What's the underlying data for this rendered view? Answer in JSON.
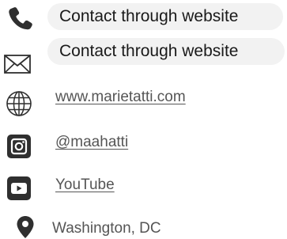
{
  "contacts": {
    "phone": {
      "icon": "phone-icon",
      "label": "Contact through website"
    },
    "email": {
      "icon": "envelope-icon",
      "label": "Contact through website"
    },
    "website": {
      "icon": "globe-icon",
      "label": "www.marietatti.com"
    },
    "instagram": {
      "icon": "instagram-icon",
      "label": "@maahatti"
    },
    "youtube": {
      "icon": "youtube-icon",
      "label": "YouTube"
    },
    "location": {
      "icon": "map-pin-icon",
      "label": "Washington, DC"
    }
  },
  "colors": {
    "icon": "#2f2f2f",
    "pill_background": "#f2f2f2",
    "link_text": "#555555"
  }
}
